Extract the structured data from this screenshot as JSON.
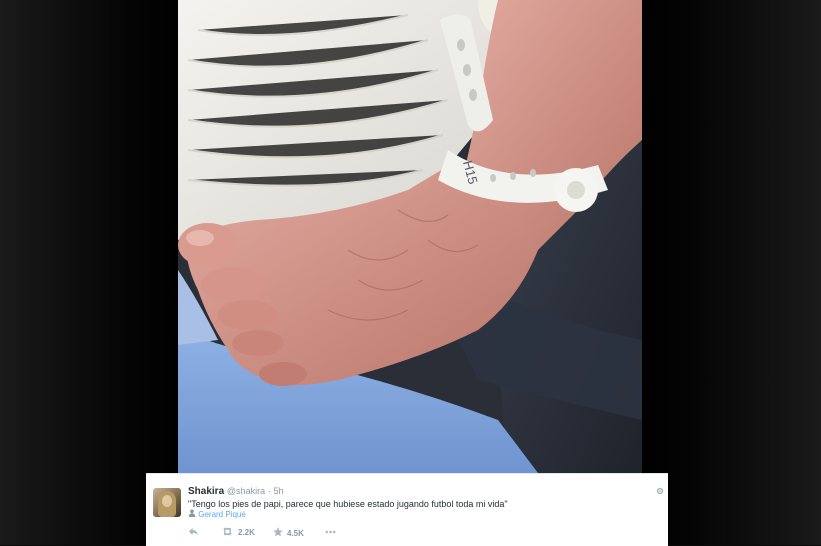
{
  "tweet": {
    "name": "Shakira",
    "handle": "@shakira",
    "separator": "·",
    "time": "5h",
    "text": "\"Tengo los pies de papi, parece que hubiese estado jugando futbol toda mi vida\"",
    "mention_icon": "person-icon",
    "mention": "Gerard Piqué",
    "actions": {
      "reply_icon": "reply-icon",
      "retweet_icon": "retweet-icon",
      "retweet_count": "2.2K",
      "favorite_icon": "star-icon",
      "favorite_count": "4.5K",
      "more_icon": "more-icon"
    }
  },
  "photo": {
    "subject": "baby foot with hospital ankle band",
    "band_text": "H15"
  },
  "colors": {
    "background": "#000000",
    "card": "#ffffff",
    "name": "#292f33",
    "muted": "#8899a6",
    "link": "#55acee"
  }
}
